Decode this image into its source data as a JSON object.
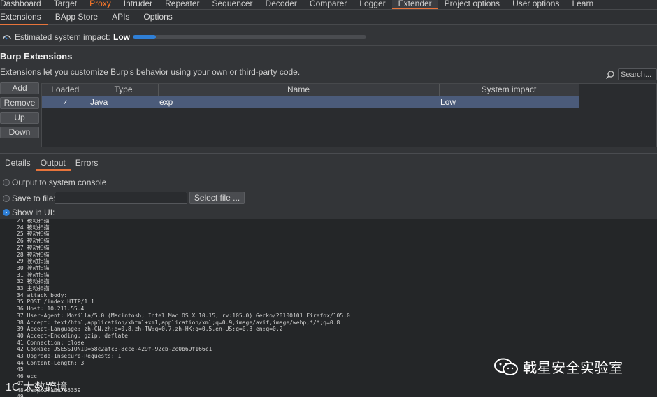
{
  "top_tabs": [
    {
      "label": "Dashboard"
    },
    {
      "label": "Target"
    },
    {
      "label": "Proxy"
    },
    {
      "label": "Intruder"
    },
    {
      "label": "Repeater"
    },
    {
      "label": "Sequencer"
    },
    {
      "label": "Decoder"
    },
    {
      "label": "Comparer"
    },
    {
      "label": "Logger"
    },
    {
      "label": "Extender"
    },
    {
      "label": "Project options"
    },
    {
      "label": "User options"
    },
    {
      "label": "Learn"
    }
  ],
  "sub_tabs": [
    {
      "label": "Extensions"
    },
    {
      "label": "BApp Store"
    },
    {
      "label": "APIs"
    },
    {
      "label": "Options"
    }
  ],
  "impact": {
    "label": "Estimated system impact:",
    "value": "Low",
    "level_fraction": 0.1
  },
  "extensions": {
    "title": "Burp Extensions",
    "description": "Extensions let you customize Burp's behavior using your own or third-party code.",
    "search_placeholder": "Search...",
    "buttons": {
      "add": "Add",
      "remove": "Remove",
      "up": "Up",
      "down": "Down"
    },
    "columns": {
      "loaded": "Loaded",
      "type": "Type",
      "name": "Name",
      "impact": "System impact"
    },
    "rows": [
      {
        "loaded": "✓",
        "type": "Java",
        "name": "exp",
        "impact": "Low"
      }
    ]
  },
  "detail_tabs": [
    {
      "label": "Details"
    },
    {
      "label": "Output"
    },
    {
      "label": "Errors"
    }
  ],
  "output_options": {
    "system_console": "Output to system console",
    "save_to_file": "Save to file:",
    "select_file": "Select file ...",
    "show_in_ui": "Show in UI:"
  },
  "console_lines": [
    "23 被动扫描",
    "24 被动扫描",
    "25 被动扫描",
    "26 被动扫描",
    "27 被动扫描",
    "28 被动扫描",
    "29 被动扫描",
    "30 被动扫描",
    "31 被动扫描",
    "32 被动扫描",
    "33 主动扫描",
    "34 attack_body:",
    "35 POST /index HTTP/1.1",
    "36 Host: 10.211.55.4",
    "37 User-Agent: Mozilla/5.0 (Macintosh; Intel Mac OS X 10.15; rv:105.0) Gecko/20100101 Firefox/105.0",
    "38 Accept: text/html,application/xhtml+xml,application/xml;q=0.9,image/avif,image/webp,*/*;q=0.8",
    "39 Accept-Language: zh-CN,zh;q=0.8,zh-TW;q=0.7,zh-HK;q=0.5,en-US;q=0.3,en;q=0.2",
    "40 Accept-Encoding: gzip, deflate",
    "41 Connection: close",
    "42 Cookie: JSESSIONID=58c2afc3-8cce-429f-92cb-2c0b69f166c1",
    "43 Upgrade-Insecure-Requests: 1",
    "44 Content-Length: 3",
    "45",
    "46 ecc",
    "47",
    "48 burp.ITaBa7f5359",
    "49"
  ],
  "watermarks": {
    "right": "戟星安全实验室",
    "left": "1C 大数跨境"
  }
}
